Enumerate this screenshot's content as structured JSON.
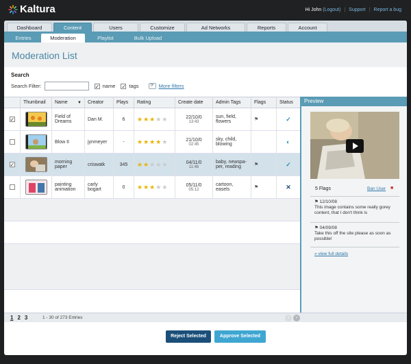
{
  "app": {
    "logo_text": "Kaltura"
  },
  "topbar": {
    "greeting": "Hi John",
    "logout": "(Logout)",
    "support": "Support",
    "report": "Report a bug",
    "separator": "|"
  },
  "tabs": [
    {
      "label": "Dashboard"
    },
    {
      "label": "Content"
    },
    {
      "label": "Users"
    },
    {
      "label": "Customize"
    },
    {
      "label": "Ad Networks"
    },
    {
      "label": "Reports"
    },
    {
      "label": "Account"
    }
  ],
  "subtabs": [
    {
      "label": "Entries"
    },
    {
      "label": "Moderation"
    },
    {
      "label": "Playlist"
    },
    {
      "label": "Bulk Upload"
    }
  ],
  "page": {
    "title": "Moderation List"
  },
  "search": {
    "heading": "Search",
    "filter_label": "Search Filter:",
    "filter_value": "",
    "name_label": "name",
    "tags_label": "tags",
    "more": "More filters"
  },
  "table": {
    "headers": [
      "",
      "Thumbnail",
      "Name",
      "Creator",
      "Plays",
      "Rating",
      "Create date",
      "Admin Tags",
      "Flags",
      "Status"
    ],
    "rows": [
      {
        "checked": true,
        "name": "Field of Dreams",
        "creator": "Dan M.",
        "plays": "6",
        "rating": 3,
        "date": "22/10/0",
        "time": "13:43",
        "tags": "sun, field, flowers",
        "flag": true,
        "status": "approved",
        "selected": false
      },
      {
        "checked": false,
        "name": "Blow II",
        "creator": "jynmeyer",
        "plays": "-",
        "rating": 4,
        "date": "21/10/0",
        "time": "02:45",
        "tags": "sky, child, blowing",
        "flag": false,
        "status": "pending",
        "selected": false
      },
      {
        "checked": true,
        "name": "morning paper",
        "creator": "criswatk",
        "plays": "345",
        "rating": 2,
        "date": "04/11/0",
        "time": "11:46",
        "tags": "baby, newspa-per, reading",
        "flag": true,
        "status": "approved",
        "selected": true
      },
      {
        "checked": false,
        "name": "painting animation",
        "creator": "carly bogart",
        "plays": "0",
        "rating": 3,
        "date": "05/11/0",
        "time": "05:12",
        "tags": "cartoon, easels",
        "flag": true,
        "status": "rejected",
        "selected": false
      }
    ]
  },
  "preview": {
    "title": "Preview",
    "flags_count": "5 Flags",
    "ban_user": "Ban User",
    "notes": [
      {
        "date": "12/10/08",
        "text": "This image contains some really gorey content, that I don't think is"
      },
      {
        "date": "04/09/08",
        "text": "Take this off the site please as soon as possible!"
      }
    ],
    "view_full": "view full details"
  },
  "pagination": {
    "pages": [
      "1",
      "2",
      "3"
    ],
    "entries": "1 - 30 of 273 Entries"
  },
  "actions": {
    "reject": "Reject Selected",
    "approve": "Approve Selected"
  },
  "colors": {
    "accent": "#5a9bb5",
    "star": "#e8b400",
    "approve": "#2a8fb8",
    "reject": "#1b4f7a"
  }
}
